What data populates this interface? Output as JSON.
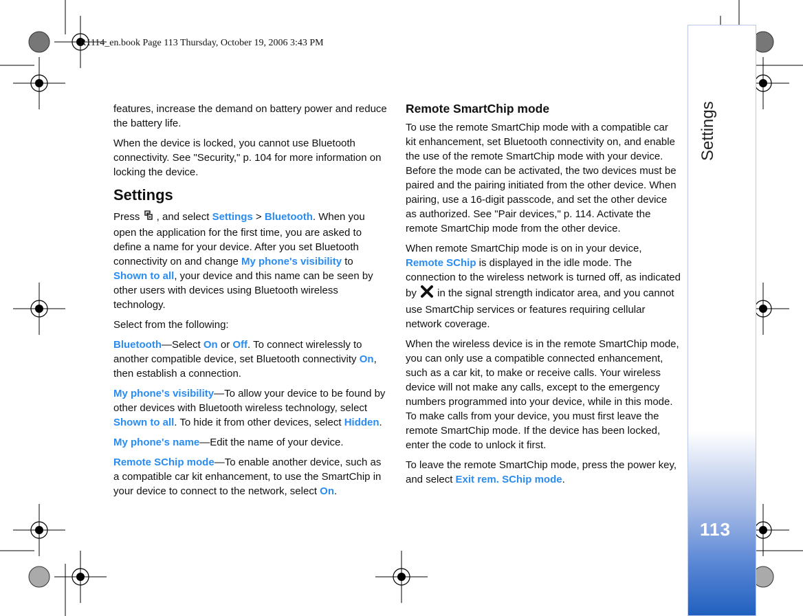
{
  "header": "R1114_en.book  Page 113  Thursday, October 19, 2006  3:43 PM",
  "side_tab": {
    "title": "Settings",
    "page_number": "113"
  },
  "colors": {
    "link": "#2a8cf0",
    "tab_blue": "#1f5fbf"
  },
  "left_column": [
    {
      "type": "p",
      "runs": [
        {
          "t": "features, increase the demand on battery power and reduce the battery life."
        }
      ]
    },
    {
      "type": "p",
      "runs": [
        {
          "t": "When the device is locked, you cannot use Bluetooth connectivity. See \"Security,\" p. 104 for more information on locking the device."
        }
      ]
    },
    {
      "type": "h2",
      "runs": [
        {
          "t": "Settings"
        }
      ]
    },
    {
      "type": "p",
      "runs": [
        {
          "t": "Press "
        },
        {
          "icon": "menu-key-icon"
        },
        {
          "t": " , and select "
        },
        {
          "t": "Settings",
          "b": true
        },
        {
          "t": " > "
        },
        {
          "t": "Bluetooth",
          "b": true
        },
        {
          "t": ". When you open the application for the first time, you are asked to define a name for your device. After you set Bluetooth connectivity on and change "
        },
        {
          "t": "My phone's visibility",
          "b": true
        },
        {
          "t": " to "
        },
        {
          "t": "Shown to all",
          "b": true
        },
        {
          "t": ", your device and this name can be seen by other users with devices using Bluetooth wireless technology."
        }
      ]
    },
    {
      "type": "p",
      "runs": [
        {
          "t": "Select from the following:"
        }
      ]
    },
    {
      "type": "p",
      "runs": [
        {
          "t": "Bluetooth",
          "b": true
        },
        {
          "t": "—Select "
        },
        {
          "t": "On",
          "b": true
        },
        {
          "t": " or "
        },
        {
          "t": "Off",
          "b": true
        },
        {
          "t": ". To connect wirelessly to another compatible device, set Bluetooth connectivity "
        },
        {
          "t": "On",
          "b": true
        },
        {
          "t": ", then establish a connection."
        }
      ]
    },
    {
      "type": "p",
      "runs": [
        {
          "t": "My phone's visibility",
          "b": true
        },
        {
          "t": "—To allow your device to be found by other devices with Bluetooth wireless technology, select "
        },
        {
          "t": "Shown to all",
          "b": true
        },
        {
          "t": ". To hide it from other devices, select "
        },
        {
          "t": "Hidden",
          "b": true
        },
        {
          "t": "."
        }
      ]
    },
    {
      "type": "p",
      "runs": [
        {
          "t": "My phone's name",
          "b": true
        },
        {
          "t": "—Edit the name of your device."
        }
      ]
    },
    {
      "type": "p",
      "runs": [
        {
          "t": "Remote SChip mode",
          "b": true
        },
        {
          "t": "—To enable another device, such as a compatible car kit enhancement, to use the SmartChip in your device to connect to the network, select "
        },
        {
          "t": "On",
          "b": true
        },
        {
          "t": "."
        }
      ]
    }
  ],
  "right_column": [
    {
      "type": "h3",
      "runs": [
        {
          "t": "Remote SmartChip mode"
        }
      ]
    },
    {
      "type": "p",
      "runs": [
        {
          "t": "To use the remote SmartChip mode with a compatible car kit enhancement, set Bluetooth connectivity on, and enable the use of the remote SmartChip mode with your device. Before the mode can be activated, the two devices must be paired and the pairing initiated from the other device. When pairing, use a 16-digit passcode, and set the other device as authorized. See \"Pair devices,\" p. 114. Activate the remote SmartChip mode from the other device."
        }
      ]
    },
    {
      "type": "p",
      "runs": [
        {
          "t": "When remote SmartChip mode is on in your device, "
        },
        {
          "t": "Remote SChip",
          "b": true
        },
        {
          "t": " is displayed in the idle mode. The connection to the wireless network is turned off, as indicated by "
        },
        {
          "icon": "no-signal-x-icon"
        },
        {
          "t": " in the signal strength indicator area, and you cannot use SmartChip services or features requiring cellular network coverage."
        }
      ]
    },
    {
      "type": "p",
      "runs": [
        {
          "t": "When the wireless device is in the remote SmartChip mode, you can only use a compatible connected enhancement, such as a car kit, to make or receive calls. Your wireless device will not make any calls, except to the emergency numbers programmed into your device, while in this mode. To make calls from your device, you must first leave the remote SmartChip mode. If the device has been locked, enter the code to unlock it first."
        }
      ]
    },
    {
      "type": "p",
      "runs": [
        {
          "t": "To leave the remote SmartChip mode, press the power key, and select "
        },
        {
          "t": "Exit rem. SChip mode",
          "b": true
        },
        {
          "t": "."
        }
      ]
    }
  ]
}
